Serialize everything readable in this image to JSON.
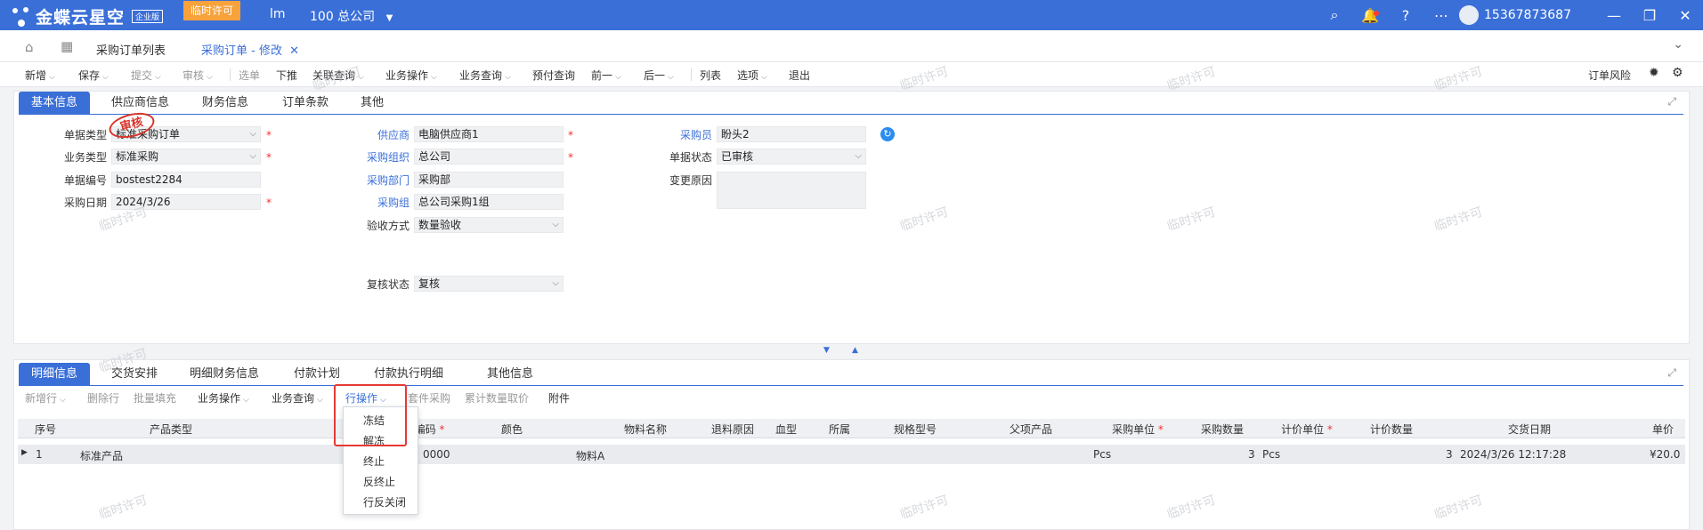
{
  "app": {
    "brand": "金蝶云星空",
    "edition": "企业版",
    "license_badge": "临时许可",
    "user_short": "lm",
    "org": "100 总公司",
    "phone": "15367873687"
  },
  "tabs": {
    "list": "采购订单列表",
    "edit": "采购订单 - 修改"
  },
  "toolbar": {
    "new": "新增",
    "save": "保存",
    "submit": "提交",
    "audit": "审核",
    "select": "选单",
    "push": "下推",
    "link": "关联查询",
    "biz": "业务操作",
    "query": "业务查询",
    "prepay": "预付查询",
    "prev": "前一",
    "next": "后一",
    "list": "列表",
    "options": "选项",
    "exit": "退出",
    "risk": "订单风险"
  },
  "header_tabs": [
    "基本信息",
    "供应商信息",
    "财务信息",
    "订单条款",
    "其他"
  ],
  "form": {
    "doc_type_label": "单据类型",
    "doc_type": "标准采购订单",
    "biz_type_label": "业务类型",
    "biz_type": "标准采购",
    "doc_no_label": "单据编号",
    "doc_no": "bostest2284",
    "date_label": "采购日期",
    "date": "2024/3/26",
    "supplier_label": "供应商",
    "supplier": "电脑供应商1",
    "purch_org_label": "采购组织",
    "purch_org": "总公司",
    "purch_dept_label": "采购部门",
    "purch_dept": "采购部",
    "purch_group_label": "采购组",
    "purch_group": "总公司采购1组",
    "check_label": "验收方式",
    "check": "数量验收",
    "recheck_label": "复核状态",
    "recheck": "复核",
    "buyer_label": "采购员",
    "buyer": "盼头2",
    "status_label": "单据状态",
    "status": "已审核",
    "change_label": "变更原因",
    "stamp": "审核"
  },
  "detail_tabs": [
    "明细信息",
    "交货安排",
    "明细财务信息",
    "付款计划",
    "付款执行明细",
    "其他信息"
  ],
  "detail_toolbar": {
    "add": "新增行",
    "del": "删除行",
    "batch": "批量填充",
    "biz": "业务操作",
    "query": "业务查询",
    "row": "行操作",
    "kit": "套件采购",
    "cumul": "累计数量取价",
    "attach": "附件"
  },
  "columns": [
    "序号",
    "产品类型",
    "编码",
    "颜色",
    "物料名称",
    "退料原因",
    "血型",
    "所属",
    "规格型号",
    "父项产品",
    "采购单位",
    "采购数量",
    "计价单位",
    "计价数量",
    "交货日期",
    "单价"
  ],
  "row": {
    "seq": "1",
    "ptype": "标准产品",
    "code": "0000",
    "name": "物料A",
    "unit": "Pcs",
    "qty": "3",
    "punit": "Pcs",
    "pqty": "3",
    "date": "2024/3/26 12:17:28",
    "price": "¥20.0"
  },
  "row_menu": [
    "冻结",
    "解冻",
    "终止",
    "反终止",
    "行反关闭"
  ],
  "watermark": "临时许可"
}
